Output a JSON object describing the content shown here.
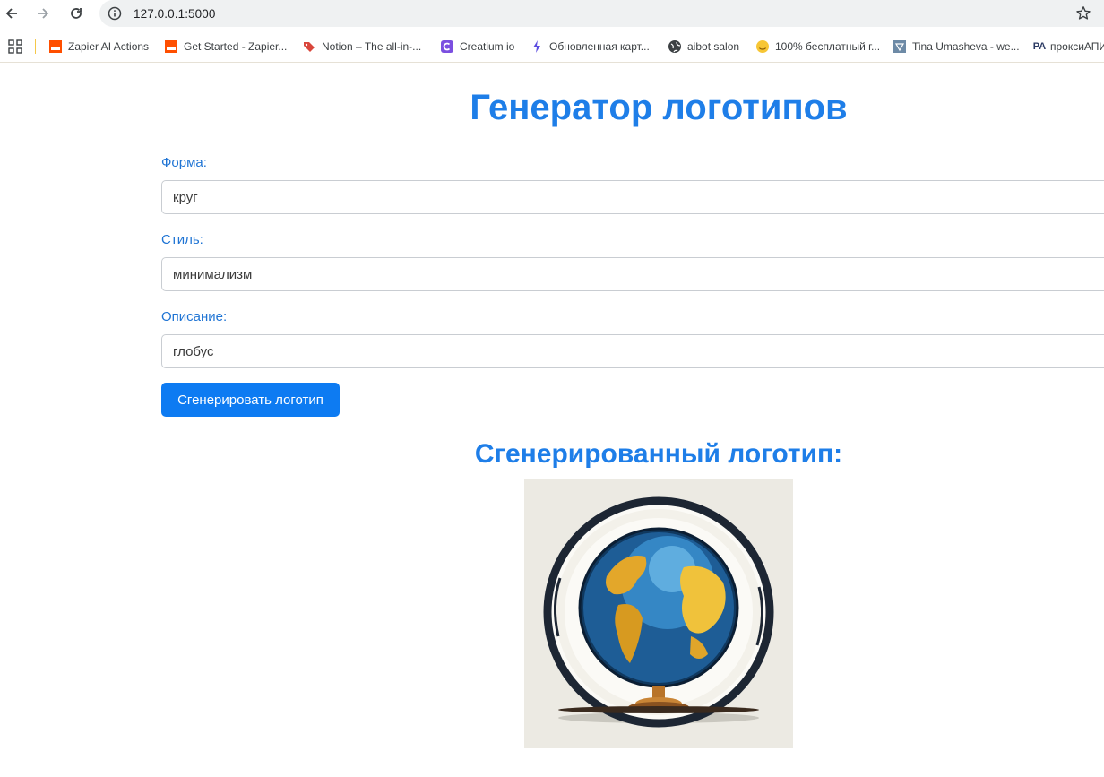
{
  "browser": {
    "url": "127.0.0.1:5000",
    "bookmarks": [
      {
        "label": "Zapier AI Actions",
        "icon": "zapier-icon"
      },
      {
        "label": "Get Started - Zapier...",
        "icon": "zapier-icon"
      },
      {
        "label": "Notion – The all-in-...",
        "icon": "tag-icon"
      },
      {
        "label": "Creatium io",
        "icon": "creatium-icon"
      },
      {
        "label": "Обновленная карт...",
        "icon": "sparkle-icon"
      },
      {
        "label": "aibot salon",
        "icon": "globe-icon"
      },
      {
        "label": "100% бесплатный г...",
        "icon": "emoji-icon"
      },
      {
        "label": "Tina Umasheva - we...",
        "icon": "triangle-icon"
      },
      {
        "label": "проксиАПИ",
        "icon": "proxy-icon"
      }
    ]
  },
  "page": {
    "title": "Генератор логотипов",
    "form": {
      "shape_label": "Форма:",
      "shape_value": "круг",
      "style_label": "Стиль:",
      "style_value": "минимализм",
      "description_label": "Описание:",
      "description_value": "глобус",
      "submit_label": "Сгенерировать логотип"
    },
    "result_title": "Сгенерированный логотип:",
    "logo_image": "globe-logo-image"
  },
  "colors": {
    "accent": "#1e7ee8",
    "button": "#0d7bf2"
  }
}
